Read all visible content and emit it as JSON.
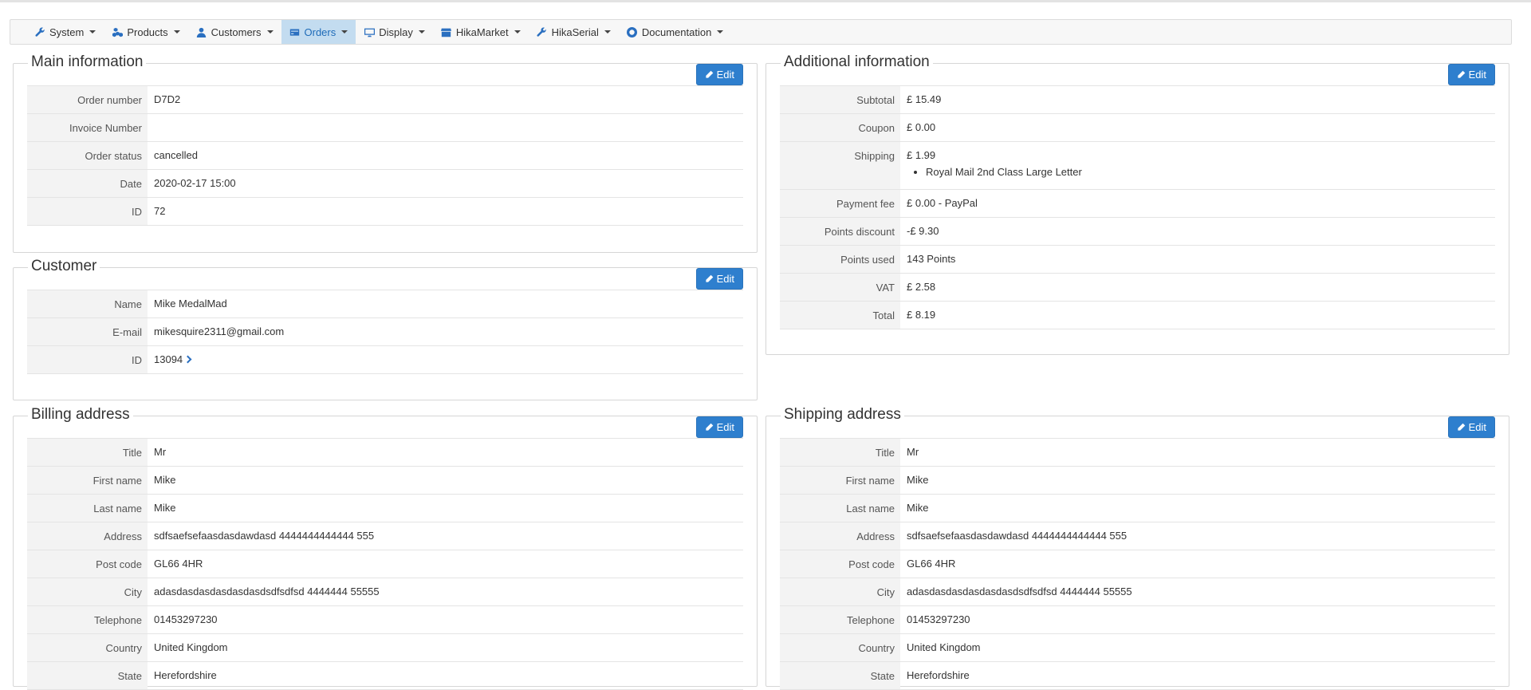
{
  "nav": [
    {
      "label": "System",
      "icon": "wrench-icon"
    },
    {
      "label": "Products",
      "icon": "cubes-icon"
    },
    {
      "label": "Customers",
      "icon": "user-icon"
    },
    {
      "label": "Orders",
      "icon": "credit-card-icon",
      "active": true
    },
    {
      "label": "Display",
      "icon": "monitor-icon"
    },
    {
      "label": "HikaMarket",
      "icon": "store-icon"
    },
    {
      "label": "HikaSerial",
      "icon": "wrench-icon"
    },
    {
      "label": "Documentation",
      "icon": "lifebuoy-icon"
    }
  ],
  "edit_label": "Edit",
  "main_info": {
    "title": "Main information",
    "rows": [
      {
        "label": "Order number",
        "value": "D7D2"
      },
      {
        "label": "Invoice Number",
        "value": ""
      },
      {
        "label": "Order status",
        "value": "cancelled"
      },
      {
        "label": "Date",
        "value": "2020-02-17 15:00"
      },
      {
        "label": "ID",
        "value": "72"
      }
    ]
  },
  "customer": {
    "title": "Customer",
    "rows": [
      {
        "label": "Name",
        "value": "Mike MedalMad"
      },
      {
        "label": "E-mail",
        "value": "mikesquire2311@gmail.com"
      },
      {
        "label": "ID",
        "value": "13094"
      }
    ]
  },
  "additional": {
    "title": "Additional information",
    "rows": [
      {
        "label": "Subtotal",
        "value": "£ 15.49"
      },
      {
        "label": "Coupon",
        "value": "£ 0.00"
      },
      {
        "label": "Shipping",
        "value": "£ 1.99",
        "bullet": "Royal Mail 2nd Class Large Letter"
      },
      {
        "label": "Payment fee",
        "value": "£ 0.00 - PayPal"
      },
      {
        "label": "Points discount",
        "value": "-£ 9.30"
      },
      {
        "label": "Points used",
        "value": "143 Points"
      },
      {
        "label": "VAT",
        "value": "£ 2.58"
      },
      {
        "label": "Total",
        "value": "£ 8.19"
      }
    ]
  },
  "billing": {
    "title": "Billing address",
    "rows": [
      {
        "label": "Title",
        "value": "Mr"
      },
      {
        "label": "First name",
        "value": "Mike"
      },
      {
        "label": "Last name",
        "value": "Mike"
      },
      {
        "label": "Address",
        "value": "sdfsaefsefaasdasdawdasd 4444444444444 555"
      },
      {
        "label": "Post code",
        "value": "GL66 4HR"
      },
      {
        "label": "City",
        "value": "adasdasdasdasdasdasdsdfsdfsd 4444444 55555"
      },
      {
        "label": "Telephone",
        "value": "01453297230"
      },
      {
        "label": "Country",
        "value": "United Kingdom"
      },
      {
        "label": "State",
        "value": "Herefordshire"
      }
    ]
  },
  "shipping": {
    "title": "Shipping address",
    "rows": [
      {
        "label": "Title",
        "value": "Mr"
      },
      {
        "label": "First name",
        "value": "Mike"
      },
      {
        "label": "Last name",
        "value": "Mike"
      },
      {
        "label": "Address",
        "value": "sdfsaefsefaasdasdawdasd 4444444444444 555"
      },
      {
        "label": "Post code",
        "value": "GL66 4HR"
      },
      {
        "label": "City",
        "value": "adasdasdasdasdasdasdsdfsdfsd 4444444 55555"
      },
      {
        "label": "Telephone",
        "value": "01453297230"
      },
      {
        "label": "Country",
        "value": "United Kingdom"
      },
      {
        "label": "State",
        "value": "Herefordshire"
      }
    ]
  }
}
